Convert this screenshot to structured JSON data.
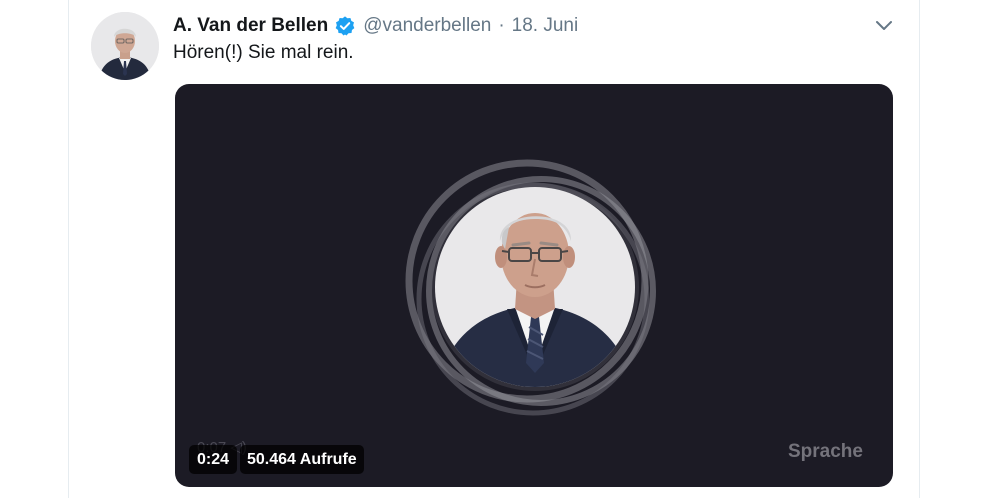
{
  "tweet": {
    "author_name": "A. Van der Bellen",
    "verified_icon": "verified-badge-icon",
    "handle": "@vanderbellen",
    "separator": "·",
    "date": "18. Juni",
    "text": "Hören(!) Sie mal rein.",
    "menu_icon": "chevron-down-icon"
  },
  "media": {
    "elapsed": "0:24",
    "views": "50.464 Aufrufe",
    "language": "Sprache",
    "faint_controls": "0:07 ◁)"
  },
  "colors": {
    "accent": "#1da1f2",
    "media_background": "#1c1b25",
    "text_primary": "#14171a",
    "text_secondary": "#657786"
  }
}
